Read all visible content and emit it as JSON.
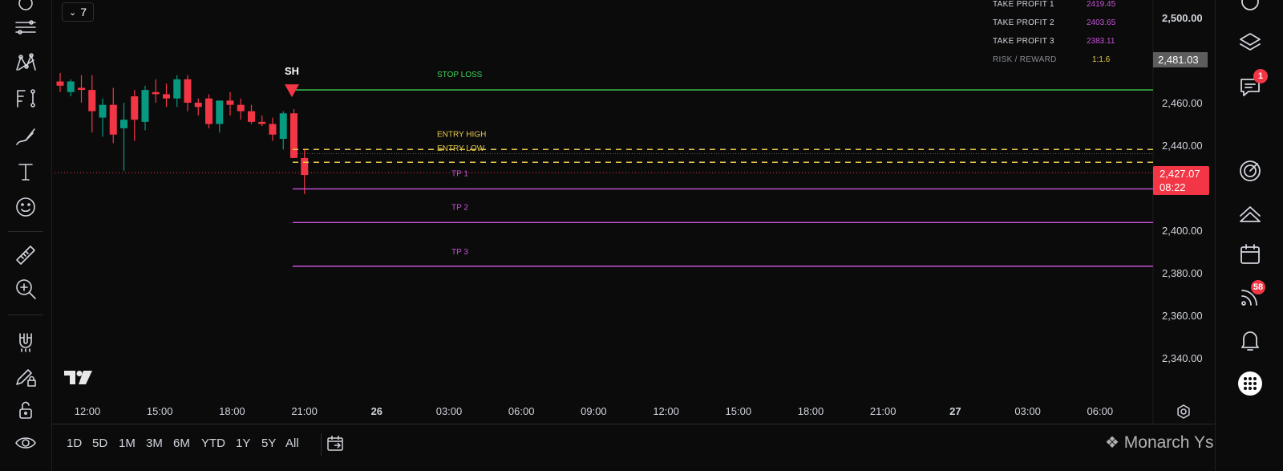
{
  "interval": {
    "label": "7"
  },
  "price_axis": {
    "ticks": [
      "2,500.00",
      "2,460.00",
      "2,440.00",
      "2,400.00",
      "2,380.00",
      "2,360.00",
      "2,340.00"
    ],
    "tick_values": [
      2500,
      2460,
      2440,
      2400,
      2380,
      2360,
      2340
    ],
    "last_price_tag": "2,481.03",
    "current_price": "2,427.07",
    "countdown": "08:22"
  },
  "time_axis": {
    "ticks": [
      "12:00",
      "15:00",
      "18:00",
      "21:00",
      "26",
      "03:00",
      "06:00",
      "09:00",
      "12:00",
      "15:00",
      "18:00",
      "21:00",
      "27",
      "03:00",
      "06:00"
    ],
    "bold": [
      false,
      false,
      false,
      false,
      true,
      false,
      false,
      false,
      false,
      false,
      false,
      false,
      true,
      false,
      false
    ]
  },
  "info_table": [
    {
      "key": "TAKE PROFIT 1",
      "value": "2419.45",
      "color": "#c851d9"
    },
    {
      "key": "TAKE PROFIT 2",
      "value": "2403.65",
      "color": "#c851d9"
    },
    {
      "key": "TAKE PROFIT 3",
      "value": "2383.11",
      "color": "#c851d9"
    },
    {
      "key": "RISK / REWARD",
      "value": "1:1.6",
      "color": "#e6c84a"
    }
  ],
  "levels": {
    "stop_loss": {
      "label": "STOP LOSS",
      "price": 2466,
      "color": "#3fd25a"
    },
    "entry_high": {
      "label": "ENTRY HIGH",
      "price": 2438,
      "color": "#e6c84a"
    },
    "entry_low": {
      "label": "ENTRY LOW",
      "price": 2432,
      "color": "#e6c84a"
    },
    "tp1": {
      "label": "TP 1",
      "price": 2419.45,
      "color": "#c851d9"
    },
    "tp2": {
      "label": "TP 2",
      "price": 2403.65,
      "color": "#c851d9"
    },
    "tp3": {
      "label": "TP 3",
      "price": 2383.11,
      "color": "#c851d9"
    }
  },
  "swing_marker": {
    "label": "SH"
  },
  "candles": [
    {
      "o": 2470,
      "h": 2474,
      "l": 2465,
      "c": 2468
    },
    {
      "o": 2465,
      "h": 2471,
      "l": 2463,
      "c": 2470
    },
    {
      "o": 2467,
      "h": 2473,
      "l": 2460,
      "c": 2466
    },
    {
      "o": 2466,
      "h": 2473,
      "l": 2446,
      "c": 2456
    },
    {
      "o": 2453,
      "h": 2462,
      "l": 2444,
      "c": 2459
    },
    {
      "o": 2459,
      "h": 2467,
      "l": 2441,
      "c": 2445
    },
    {
      "o": 2448,
      "h": 2460,
      "l": 2428,
      "c": 2452
    },
    {
      "o": 2463,
      "h": 2466,
      "l": 2442,
      "c": 2452
    },
    {
      "o": 2451,
      "h": 2468,
      "l": 2447,
      "c": 2466
    },
    {
      "o": 2465,
      "h": 2471,
      "l": 2460,
      "c": 2464
    },
    {
      "o": 2464,
      "h": 2469,
      "l": 2458,
      "c": 2462
    },
    {
      "o": 2462,
      "h": 2473,
      "l": 2458,
      "c": 2471
    },
    {
      "o": 2471,
      "h": 2473,
      "l": 2456,
      "c": 2460
    },
    {
      "o": 2460,
      "h": 2462,
      "l": 2454,
      "c": 2458
    },
    {
      "o": 2462,
      "h": 2464,
      "l": 2448,
      "c": 2450
    },
    {
      "o": 2450,
      "h": 2461,
      "l": 2446,
      "c": 2461
    },
    {
      "o": 2461,
      "h": 2465,
      "l": 2454,
      "c": 2459
    },
    {
      "o": 2459,
      "h": 2462,
      "l": 2452,
      "c": 2456
    },
    {
      "o": 2456,
      "h": 2459,
      "l": 2450,
      "c": 2451
    },
    {
      "o": 2451,
      "h": 2454,
      "l": 2449,
      "c": 2450
    },
    {
      "o": 2450,
      "h": 2453,
      "l": 2442,
      "c": 2445
    },
    {
      "o": 2443,
      "h": 2456,
      "l": 2438,
      "c": 2455
    },
    {
      "o": 2455,
      "h": 2457,
      "l": 2434,
      "c": 2434
    },
    {
      "o": 2434,
      "h": 2438,
      "l": 2417,
      "c": 2426
    }
  ],
  "bottom_bar": {
    "ranges": [
      "1D",
      "5D",
      "1M",
      "3M",
      "6M",
      "YTD",
      "1Y",
      "5Y",
      "All"
    ],
    "watermark": "Monarch Ys"
  },
  "right_toolbar": {
    "chat_badge": "1",
    "feed_badge": "58"
  },
  "colors": {
    "up": "#089981",
    "down": "#f23645",
    "background": "#0b0b0b"
  }
}
